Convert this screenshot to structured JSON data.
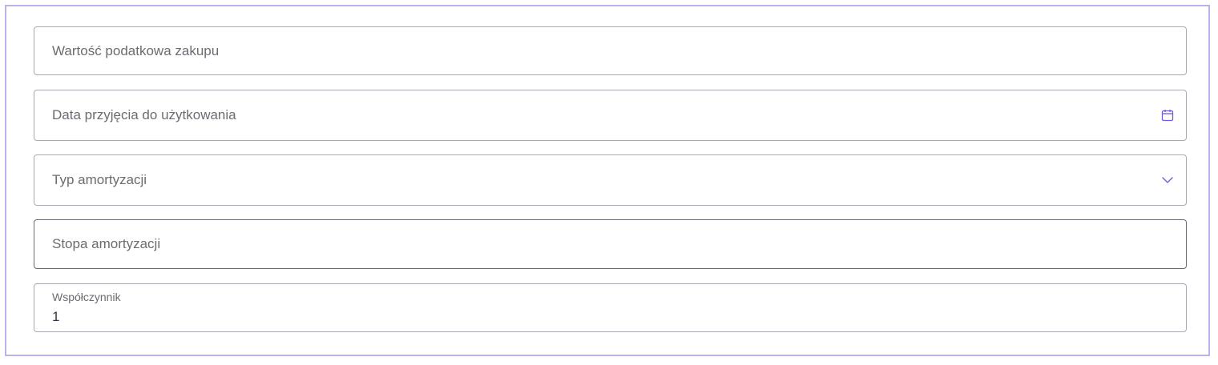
{
  "form": {
    "purchase_value": {
      "placeholder": "Wartość podatkowa zakupu"
    },
    "commissioning_date": {
      "placeholder": "Data przyjęcia do użytkowania",
      "icon": "calendar-icon"
    },
    "depreciation_type": {
      "placeholder": "Typ amortyzacji",
      "icon": "chevron-down-icon"
    },
    "depreciation_rate": {
      "placeholder": "Stopa amortyzacji"
    },
    "coefficient": {
      "label": "Współczynnik",
      "value": "1"
    }
  },
  "colors": {
    "panel_border": "#b9b3ec",
    "icon_accent": "#6c5fd6",
    "field_border": "#a9a9b2",
    "placeholder_text": "#6b6b72"
  }
}
